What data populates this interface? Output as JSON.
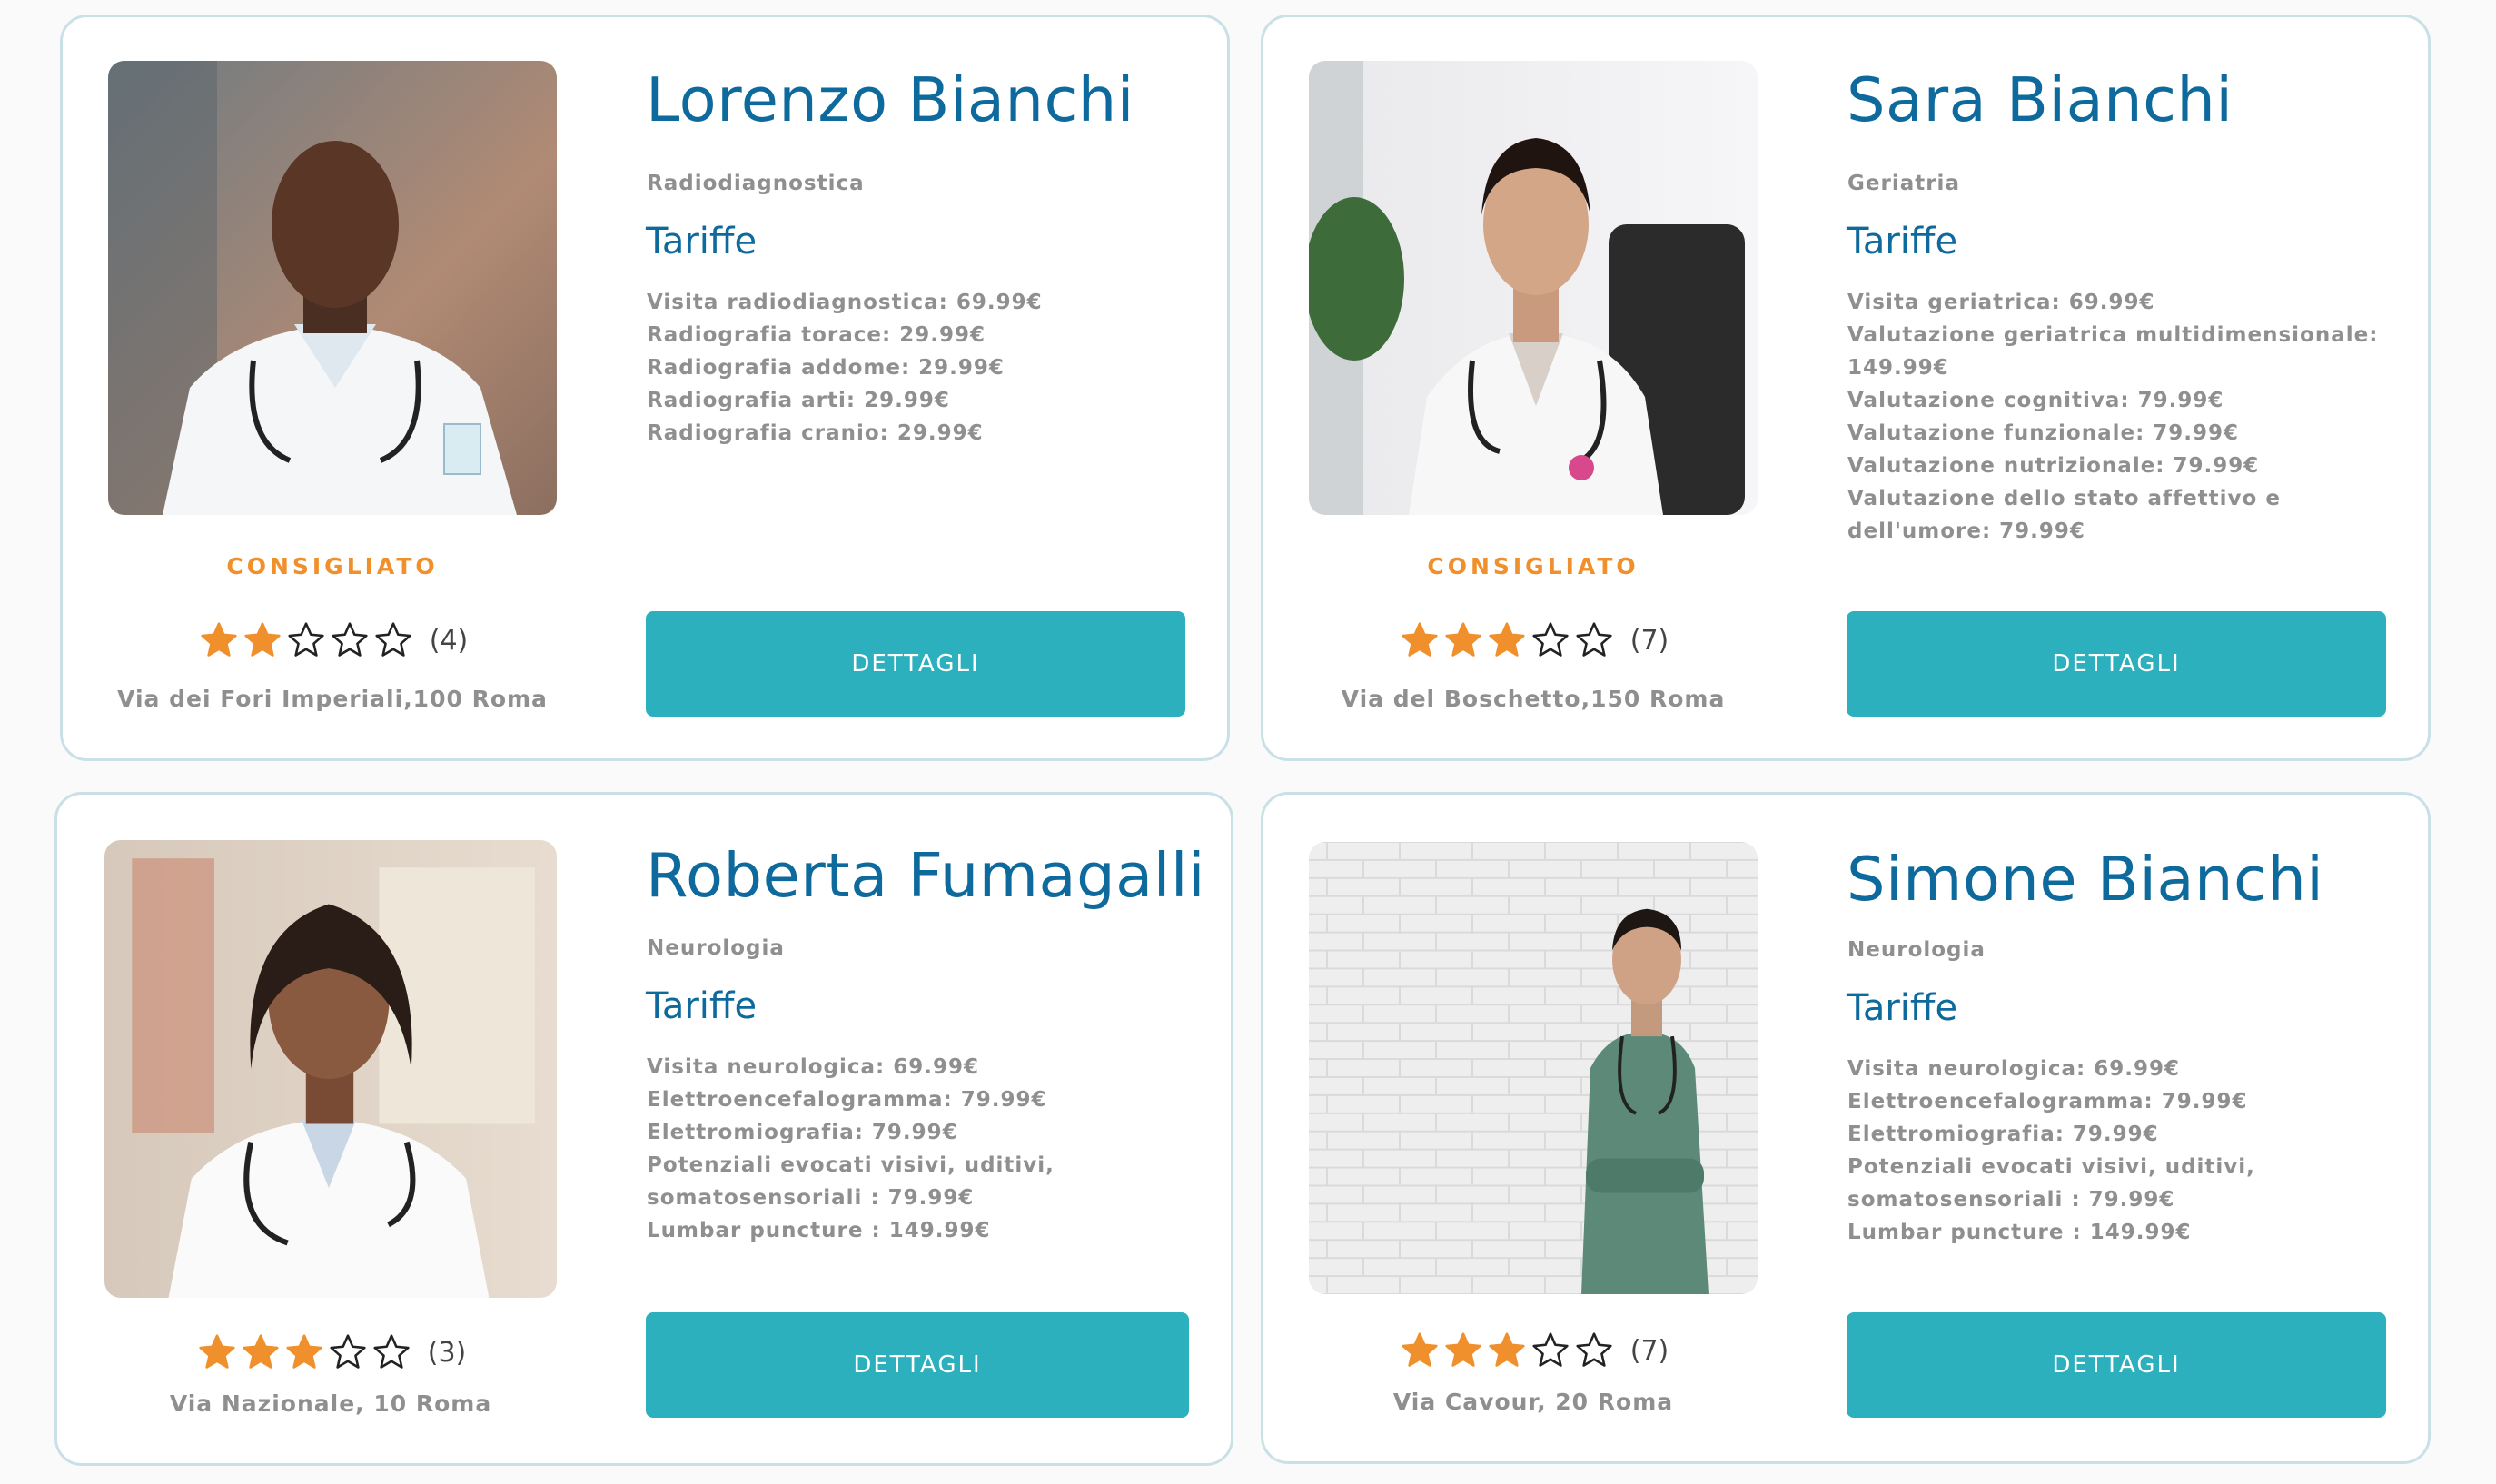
{
  "colors": {
    "name": "#0e6a9c",
    "muted": "#8f8f8f",
    "accent_orange": "#f0902c",
    "button": "#2db0bd",
    "card_border": "#c9e1e6"
  },
  "icons": {
    "star_full": "star-filled-icon",
    "star_empty": "star-outline-icon"
  },
  "cards": [
    {
      "name": "Lorenzo Bianchi",
      "specialty": "Radiodiagnostica",
      "tariffe_title": "Tariffe",
      "fees": [
        "Visita radiodiagnostica: 69.99€",
        "Radiografia torace: 29.99€",
        "Radiografia addome: 29.99€",
        "Radiografia arti: 29.99€",
        "Radiografia cranio: 29.99€"
      ],
      "badge": "CONSIGLIATO",
      "rating": 2,
      "rating_max": 5,
      "reviews": "(4)",
      "address": "Via dei Fori Imperiali,100 Roma",
      "button_label": "DETTAGLI"
    },
    {
      "name": "Sara Bianchi",
      "specialty": "Geriatria",
      "tariffe_title": "Tariffe",
      "fees": [
        "Visita geriatrica: 69.99€",
        "Valutazione geriatrica multidimensionale: 149.99€",
        "Valutazione cognitiva: 79.99€",
        "Valutazione funzionale: 79.99€",
        "Valutazione nutrizionale: 79.99€",
        "Valutazione dello stato affettivo e dell'umore: 79.99€"
      ],
      "badge": "CONSIGLIATO",
      "rating": 3,
      "rating_max": 5,
      "reviews": "(7)",
      "address": "Via del Boschetto,150 Roma",
      "button_label": "DETTAGLI"
    },
    {
      "name": "Roberta Fumagalli",
      "specialty": "Neurologia",
      "tariffe_title": "Tariffe",
      "fees": [
        "Visita neurologica: 69.99€",
        "Elettroencefalogramma: 79.99€",
        "Elettromiografia: 79.99€",
        "Potenziali evocati visivi, uditivi, somatosensoriali : 79.99€",
        "Lumbar puncture : 149.99€"
      ],
      "badge": "",
      "rating": 3,
      "rating_max": 5,
      "reviews": "(3)",
      "address": "Via Nazionale, 10 Roma",
      "button_label": "DETTAGLI"
    },
    {
      "name": "Simone Bianchi",
      "specialty": "Neurologia",
      "tariffe_title": "Tariffe",
      "fees": [
        "Visita neurologica: 69.99€",
        "Elettroencefalogramma: 79.99€",
        "Elettromiografia: 79.99€",
        "Potenziali evocati visivi, uditivi, somatosensoriali : 79.99€",
        "Lumbar puncture : 149.99€"
      ],
      "badge": "",
      "rating": 3,
      "rating_max": 5,
      "reviews": "(7)",
      "address": "Via Cavour, 20 Roma",
      "button_label": "DETTAGLI"
    }
  ]
}
